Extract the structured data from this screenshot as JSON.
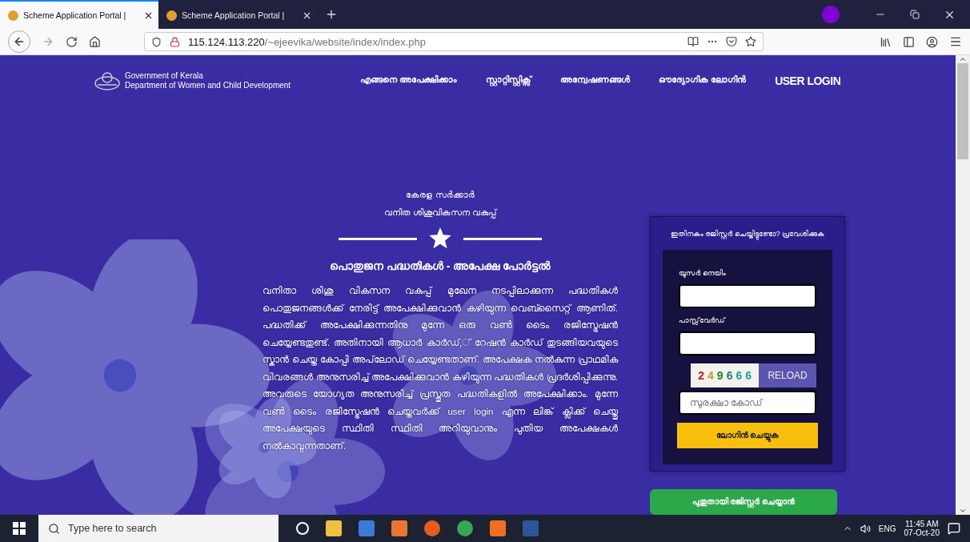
{
  "browser": {
    "tabs": [
      {
        "label": "Scheme Application Portal | ",
        "selected": true
      },
      {
        "label": "Scheme Application Portal | ",
        "selected": false
      }
    ],
    "url": {
      "host": "115.124.113.220",
      "path": "/~ejeevika/website/index/index.php"
    }
  },
  "header": {
    "org_lines": [
      "Government of Kerala",
      "Department of Women and Child Development"
    ],
    "nav": [
      "എങ്ങനെ അപേക്ഷിക്കാം",
      "സ്റ്റാറ്റിസ്റ്റിക്സ്",
      "അന്വേഷണങ്ങൾ",
      "ഔദ്യോഗിക ലോഗിൻ",
      "USER LOGIN"
    ]
  },
  "intro": {
    "lines": [
      "കേരള സർക്കാർ",
      "വനിത ശിശുവികസന വകുപ്പ്"
    ],
    "heading": "പൊതുജന പദ്ധതികൾ - അപേക്ഷ പോർട്ടൽ",
    "paragraph": "വനിതാ ശിശു വികസന വകുപ്പ് മുഖേന നടപ്പിലാക്കുന്ന പദ്ധതികൾ പൊതുജനങ്ങൾക്ക് നേരിട്ട് അപേക്ഷിക്കുവാൻ കഴിയുന്ന വെബ്സൈറ്റ് ആണിത്. പദ്ധതിക്ക് അപേക്ഷിക്കുന്നതിനു മുന്നേ ഒരു വൺ ടൈം രജിസ്ട്രേഷൻ ചെയ്യേണ്ടതുണ്ട്. അതിനായി ആധാർ കാർഡ്,് റേഷൻ കാർഡ് തുടങ്ങിയവയുടെ സ്കാൻ ചെയ്ത കോപ്പി അപ്‌ലോഡ് ചെയ്യേണ്ടതാണ്. അപേക്ഷക നൽകുന്ന പ്രാഥമിക വിവരങ്ങൾ അനുസരിച്ച് അപേക്ഷിക്കുവാൻ കഴിയുന്ന പദ്ധതികൾ പ്രദർശിപ്പിക്കുന്നു. അവരുടെ യോഗ്യത അനുസരിച്ച് പ്രസ്തുത പദ്ധതികളിൽ അപേക്ഷിക്കാം. മുന്നേ വൺ ടൈം രജിസ്ട്രേഷൻ ചെയ്തവർക്ക് user login എന്ന ലിങ്ക് ക്ലിക്ക് ചെയ്തു അപേക്ഷയുടെ സ്ഥിതി സ്ഥിതി അറിയുവാനും പുതിയ അപേക്ഷകൾ നൽകാവുന്നതാണ്."
  },
  "login": {
    "title": "ഇതിനകം രജിസ്റ്റർ ചെയ്തിട്ടുണ്ടോ? പ്രവേശിക്കുക",
    "fields": [
      {
        "label": "യൂസർ നെയിം"
      },
      {
        "label": "പാസ്സ്‌വേർഡ്"
      }
    ],
    "captcha": "249666",
    "reload": "RELOAD",
    "code_placeholder": "സുരക്ഷാ കോഡ്",
    "submit": "ലോഗിൻ ചെയ്യുക",
    "register": "പുതുതായി രജിസ്റ്റർ ചെയ്യാൻ"
  },
  "taskbar": {
    "search_placeholder": "Type here to search",
    "language": "ENG",
    "time": "11:45 AM",
    "date": "07-Oct-20"
  }
}
